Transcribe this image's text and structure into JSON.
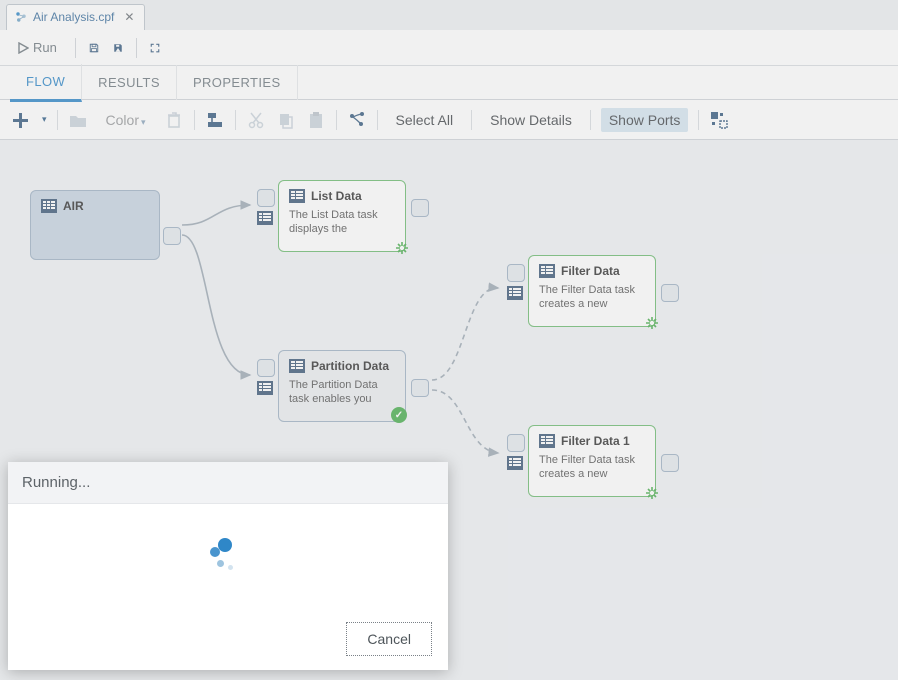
{
  "file_tab": {
    "title": "Air Analysis.cpf"
  },
  "top_toolbar": {
    "run_label": "Run"
  },
  "view_tabs": {
    "flow": "FLOW",
    "results": "RESULTS",
    "properties": "PROPERTIES"
  },
  "flow_toolbar": {
    "color_label": "Color",
    "select_all": "Select All",
    "show_details": "Show Details",
    "show_ports": "Show Ports"
  },
  "nodes": {
    "air": {
      "title": "AIR"
    },
    "list_data": {
      "title": "List Data",
      "desc": "The List Data task displays the"
    },
    "partition_data": {
      "title": "Partition Data",
      "desc": "The Partition Data task enables you"
    },
    "filter_data": {
      "title": "Filter Data",
      "desc": "The Filter Data task creates a new"
    },
    "filter_data_1": {
      "title": "Filter Data 1",
      "desc": "The Filter Data task creates a new"
    }
  },
  "dialog": {
    "title": "Running...",
    "cancel": "Cancel"
  }
}
